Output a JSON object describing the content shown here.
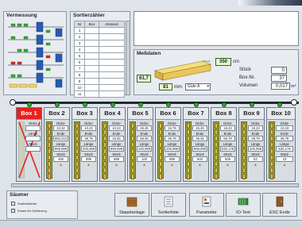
{
  "vermessung": {
    "title": "Vermessung"
  },
  "sortierzaehler": {
    "title": "Sortierzähler",
    "headers": [
      "Nr",
      "Box",
      "Abstand"
    ],
    "rows": [
      "1",
      "2",
      "3",
      "4",
      "5",
      "6",
      "7",
      "8",
      "9",
      "10",
      "11"
    ]
  },
  "messdaten": {
    "title": "Meßdaten",
    "length_value": "350",
    "length_unit": "cm",
    "height_value": "61,7",
    "width_value": "81",
    "width_unit": "mm",
    "quality_select": "Güte A",
    "stueck_label": "Stück",
    "stueck_value": "0",
    "boxnr_label": "Box-Nr.",
    "boxnr_value": "37",
    "volumen_label": "Volumen",
    "volumen_value": "0,017",
    "volumen_unit": "m³"
  },
  "boxes": [
    {
      "name": "Box 1",
      "active": true,
      "labels": [
        "Dicke",
        "Länge",
        "Stück"
      ],
      "values": [
        "",
        "",
        ""
      ]
    },
    {
      "name": "Box 2",
      "active": false,
      "labels": [
        "Dicke",
        "Ende",
        "Länge",
        "Stück"
      ],
      "values": [
        "23,32",
        "950,210",
        "999,999",
        "466"
      ]
    },
    {
      "name": "Box 3",
      "active": false,
      "labels": [
        "Dicke",
        "Ende",
        "Länge",
        "Stück"
      ],
      "values": [
        "10,23",
        "38,79",
        "200,999",
        "999"
      ]
    },
    {
      "name": "Box 4",
      "active": false,
      "labels": [
        "Dicke",
        "Ende",
        "Länge",
        "Stück"
      ],
      "values": [
        "10,23",
        "15,45",
        "999,999",
        "999"
      ]
    },
    {
      "name": "Box 5",
      "active": false,
      "labels": [
        "Dicke",
        "Ende",
        "Länge",
        "Stück"
      ],
      "values": [
        "25,45",
        "55,45",
        "100,999",
        "100"
      ]
    },
    {
      "name": "Box 6",
      "active": false,
      "labels": [
        "Dicke",
        "Ende",
        "Länge",
        "Stück"
      ],
      "values": [
        "15,79",
        "35,78",
        "100,999",
        "999"
      ]
    },
    {
      "name": "Box 7",
      "active": false,
      "labels": [
        "Dicke",
        "Ende",
        "Länge",
        "Stück"
      ],
      "values": [
        "25,45",
        "35,45",
        "999,999",
        "500"
      ]
    },
    {
      "name": "Box 8",
      "active": false,
      "labels": [
        "Dicke",
        "Ende",
        "Länge",
        "Stück"
      ],
      "values": [
        "18,23",
        "58,78",
        "530,178",
        "509"
      ]
    },
    {
      "name": "Box 9",
      "active": false,
      "labels": [
        "Dicke",
        "Ende",
        "Länge",
        "Stück"
      ],
      "values": [
        "18,23",
        "38,79",
        "100,999",
        "62"
      ]
    },
    {
      "name": "Box 10",
      "active": false,
      "labels": [
        "Dicke",
        "Ende",
        "Länge",
        "Stück"
      ],
      "values": [
        "10,23",
        "38,79",
        "530,178",
        "23"
      ]
    }
  ],
  "saeumer": {
    "title": "Säumer",
    "options": [
      "Sortierbetrieb",
      "Ersatz für Sortierung"
    ]
  },
  "toolbar": [
    {
      "label": "Stapelanlage",
      "icon": "stack-icon"
    },
    {
      "label": "Sortierliste",
      "icon": "list-icon"
    },
    {
      "label": "Parameter",
      "icon": "parameter-icon"
    },
    {
      "label": "IO-Test",
      "icon": "io-test-icon"
    },
    {
      "label": "ESC Ende",
      "icon": "exit-door-icon"
    }
  ],
  "colors": {
    "active_box": "#e8211d",
    "led_on": "#2bb02b",
    "roller": "#2a5bb0",
    "timber": "#e5c04a"
  }
}
